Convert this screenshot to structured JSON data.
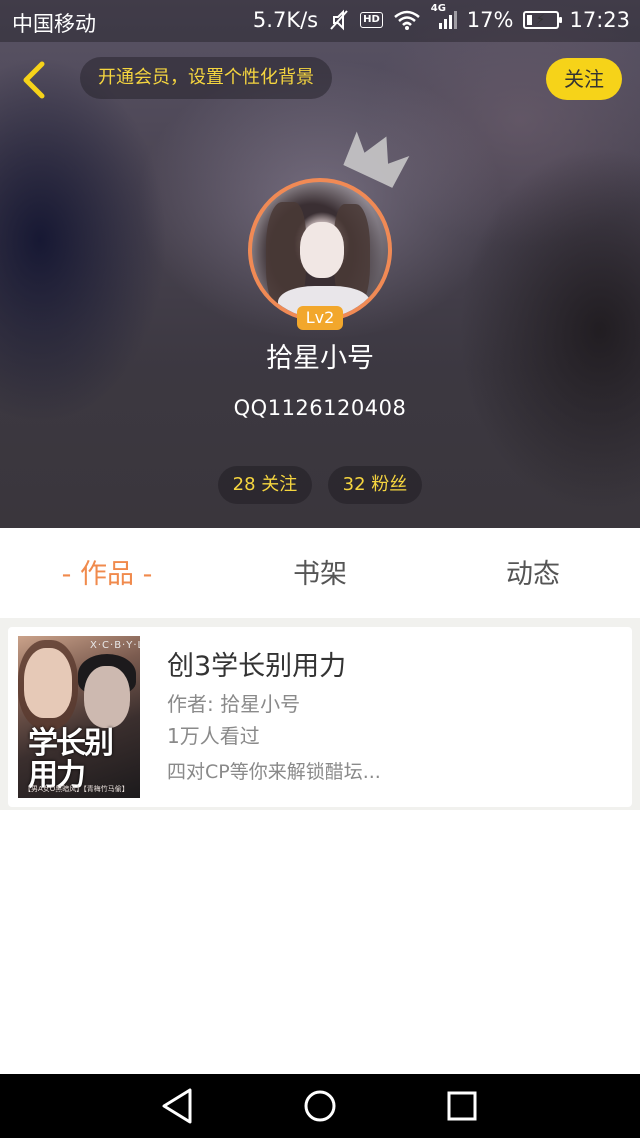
{
  "status_bar": {
    "carrier": "中国移动",
    "net_speed": "5.7K/s",
    "network_type": "4G",
    "hd_label": "HD",
    "battery_percent": "17%",
    "battery_level": 0.17,
    "time": "17:23"
  },
  "header": {
    "vip_prompt": "开通会员，设置个性化背景",
    "follow_label": "关注"
  },
  "profile": {
    "level": "Lv2",
    "username": "拾星小号",
    "user_id": "QQ1126120408",
    "following": "28 关注",
    "fans": "32 粉丝"
  },
  "tabs": [
    {
      "label": "- 作品 -",
      "active": true
    },
    {
      "label": "书架",
      "active": false
    },
    {
      "label": "动态",
      "active": false
    }
  ],
  "books": [
    {
      "title": "创3学长别用力",
      "author": "作者: 拾星小号",
      "views": "1万人看过",
      "description": "四对CP等你来解锁醋坛...",
      "cover_title": "学长别用力",
      "cover_top": "X·C·B·Y·L",
      "cover_bottom": "【男A女O黑暗风】【青梅竹马偷】"
    }
  ],
  "colors": {
    "accent_orange": "#f08a4c",
    "accent_yellow": "#f6d319",
    "pill_text": "#f5d53f",
    "level_badge": "#f2a72c"
  },
  "icons": {
    "back": "chevron-left-icon",
    "crown": "crown-icon",
    "mute": "mute-icon",
    "wifi": "wifi-icon",
    "signal": "signal-icon",
    "battery": "battery-charging-icon",
    "nav_back": "triangle-back-icon",
    "nav_home": "circle-home-icon",
    "nav_recent": "square-recent-icon"
  }
}
